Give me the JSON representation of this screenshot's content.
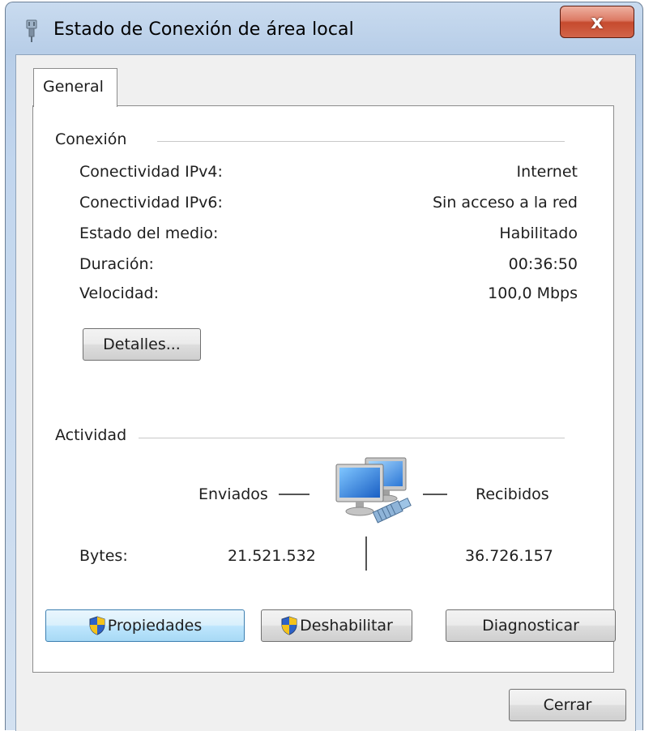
{
  "window": {
    "title": "Estado de Conexión de área local",
    "close_label": "x"
  },
  "tabs": [
    {
      "label": "General"
    }
  ],
  "conexion": {
    "heading": "Conexión",
    "rows": [
      {
        "label": "Conectividad IPv4:",
        "value": "Internet"
      },
      {
        "label": "Conectividad IPv6:",
        "value": "Sin acceso a la red"
      },
      {
        "label": "Estado del medio:",
        "value": "Habilitado"
      },
      {
        "label": "Duración:",
        "value": "00:36:50"
      },
      {
        "label": "Velocidad:",
        "value": "100,0 Mbps"
      }
    ],
    "details_button": "Detalles..."
  },
  "actividad": {
    "heading": "Actividad",
    "sent_label": "Enviados",
    "received_label": "Recibidos",
    "bytes_label": "Bytes:",
    "bytes_sent": "21.521.532",
    "bytes_received": "36.726.157"
  },
  "buttons": {
    "properties": "Propiedades",
    "disable": "Deshabilitar",
    "diagnose": "Diagnosticar",
    "close": "Cerrar"
  },
  "colors": {
    "frame": "#b8cee8",
    "client_bg": "#f0f0f0",
    "panel_bg": "#ffffff",
    "close_button": "#c64a2e",
    "focus_button": "#bee6fd"
  },
  "icons": {
    "title": "network-plug-icon",
    "activity": "network-computers-icon",
    "uac": "uac-shield-icon"
  }
}
